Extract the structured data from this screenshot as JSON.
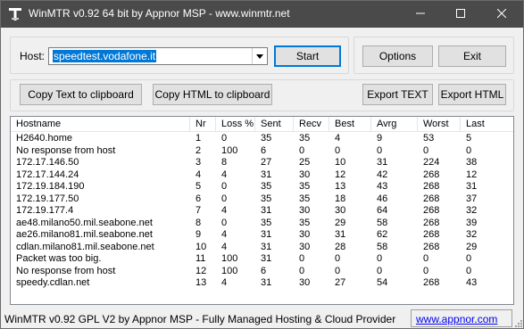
{
  "window": {
    "title": "WinMTR v0.92 64 bit by Appnor MSP - www.winmtr.net"
  },
  "host": {
    "label": "Host:",
    "value": "speedtest.vodafone.it"
  },
  "buttons": {
    "start": "Start",
    "options": "Options",
    "exit": "Exit",
    "copy_text": "Copy Text to clipboard",
    "copy_html": "Copy HTML to clipboard",
    "export_text": "Export TEXT",
    "export_html": "Export HTML"
  },
  "table": {
    "columns": [
      "Hostname",
      "Nr",
      "Loss %",
      "Sent",
      "Recv",
      "Best",
      "Avrg",
      "Worst",
      "Last"
    ],
    "rows": [
      [
        "H2640.home",
        "1",
        "0",
        "35",
        "35",
        "4",
        "9",
        "53",
        "5"
      ],
      [
        "No response from host",
        "2",
        "100",
        "6",
        "0",
        "0",
        "0",
        "0",
        "0"
      ],
      [
        "172.17.146.50",
        "3",
        "8",
        "27",
        "25",
        "10",
        "31",
        "224",
        "38"
      ],
      [
        "172.17.144.24",
        "4",
        "4",
        "31",
        "30",
        "12",
        "42",
        "268",
        "12"
      ],
      [
        "172.19.184.190",
        "5",
        "0",
        "35",
        "35",
        "13",
        "43",
        "268",
        "31"
      ],
      [
        "172.19.177.50",
        "6",
        "0",
        "35",
        "35",
        "18",
        "46",
        "268",
        "37"
      ],
      [
        "172.19.177.4",
        "7",
        "4",
        "31",
        "30",
        "30",
        "64",
        "268",
        "32"
      ],
      [
        "ae48.milano50.mil.seabone.net",
        "8",
        "0",
        "35",
        "35",
        "29",
        "58",
        "268",
        "39"
      ],
      [
        "ae26.milano81.mil.seabone.net",
        "9",
        "4",
        "31",
        "30",
        "31",
        "62",
        "268",
        "32"
      ],
      [
        "cdlan.milano81.mil.seabone.net",
        "10",
        "4",
        "31",
        "30",
        "28",
        "58",
        "268",
        "29"
      ],
      [
        "Packet was too big.",
        "11",
        "100",
        "31",
        "0",
        "0",
        "0",
        "0",
        "0"
      ],
      [
        "No response from host",
        "12",
        "100",
        "6",
        "0",
        "0",
        "0",
        "0",
        "0"
      ],
      [
        "speedy.cdlan.net",
        "13",
        "4",
        "31",
        "30",
        "27",
        "54",
        "268",
        "43"
      ]
    ]
  },
  "status": {
    "text": "WinMTR v0.92 GPL V2 by Appnor MSP - Fully Managed Hosting & Cloud Provider",
    "link": "www.appnor.com"
  },
  "colors": {
    "titlebar": "#4a4a4a",
    "selection": "#0078d7",
    "link": "#0000ee"
  }
}
